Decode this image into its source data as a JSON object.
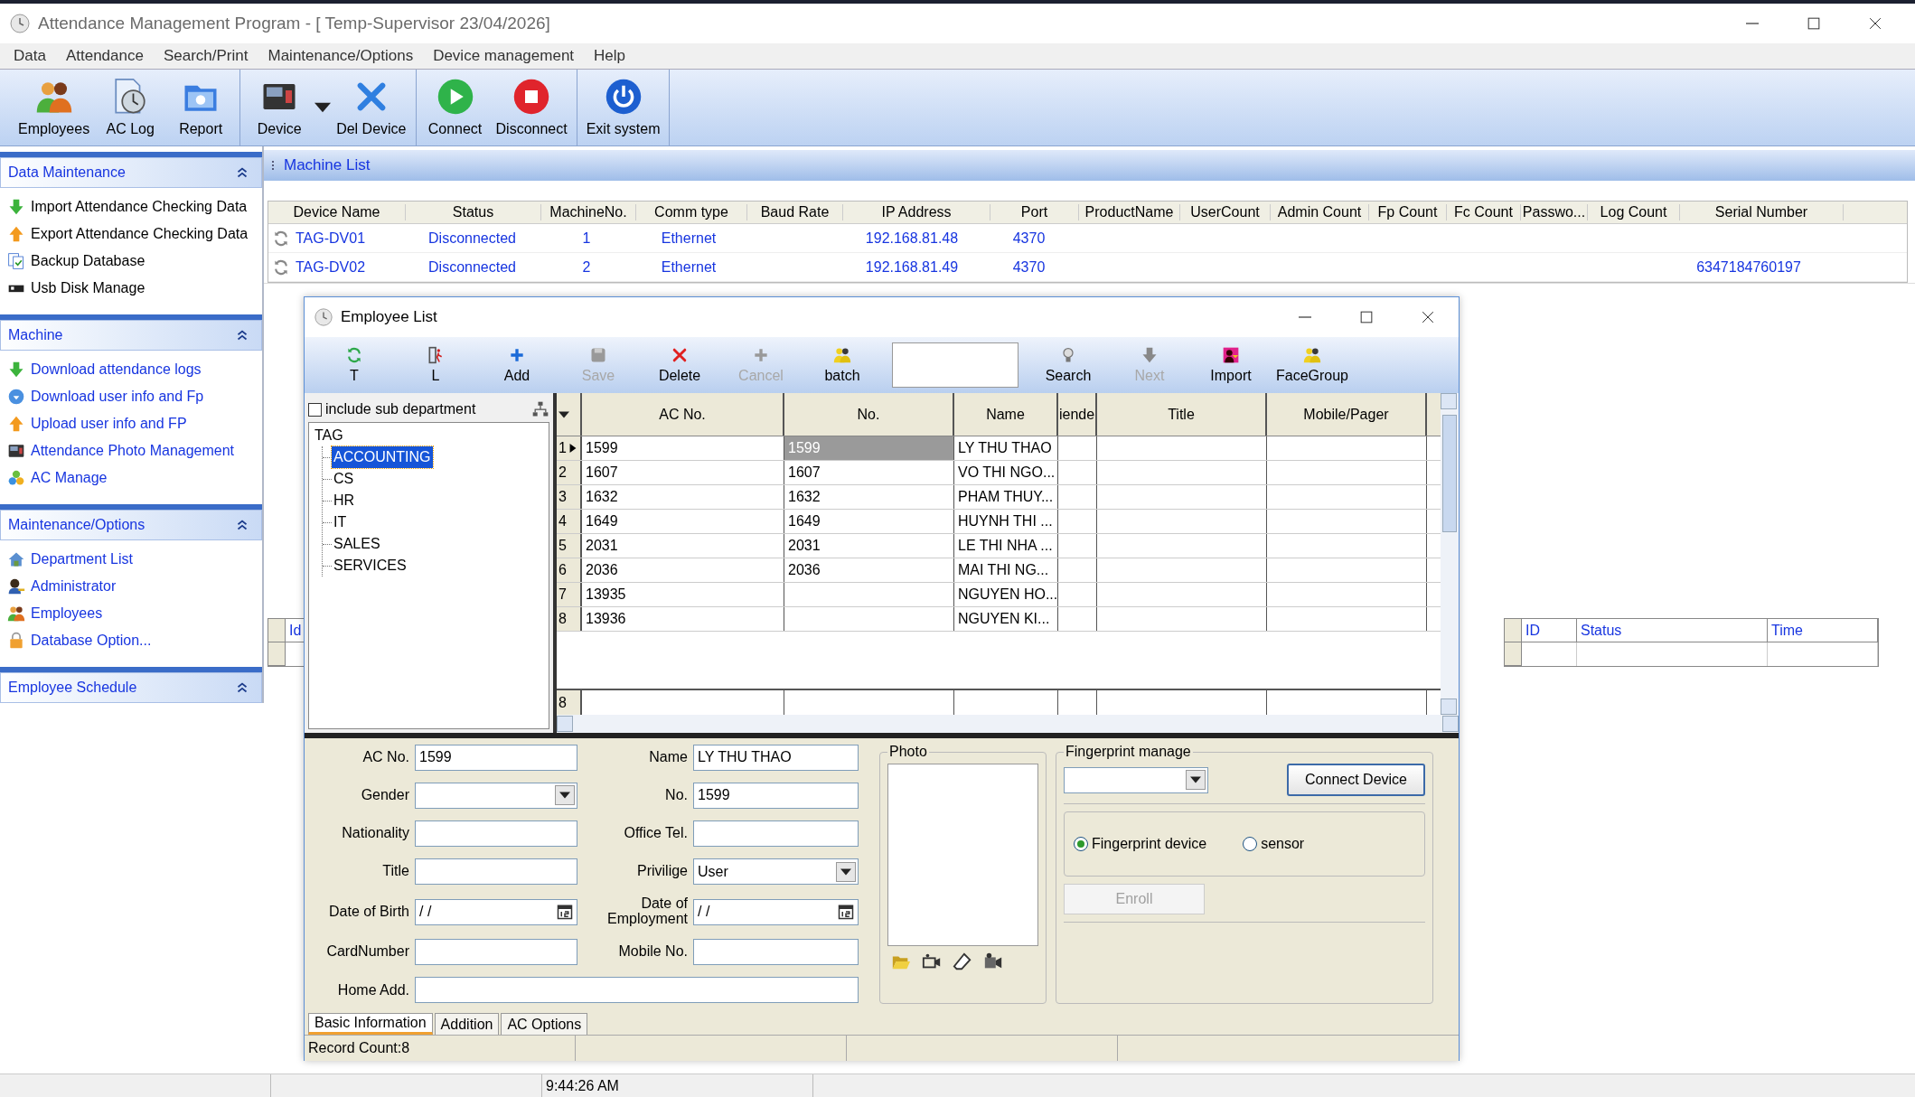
{
  "window": {
    "title": "Attendance Management Program - [ Temp-Supervisor 23/04/2026]"
  },
  "menu": [
    "Data",
    "Attendance",
    "Search/Print",
    "Maintenance/Options",
    "Device management",
    "Help"
  ],
  "toolbar": [
    {
      "buttons": [
        {
          "label": "Employees",
          "dropdown": false
        },
        {
          "label": "AC Log",
          "dropdown": false
        },
        {
          "label": "Report",
          "dropdown": false
        }
      ]
    },
    {
      "buttons": [
        {
          "label": "Device",
          "dropdown": true
        },
        {
          "label": "Del Device",
          "dropdown": false
        }
      ]
    },
    {
      "buttons": [
        {
          "label": "Connect",
          "dropdown": false
        },
        {
          "label": "Disconnect",
          "dropdown": false
        }
      ]
    },
    {
      "buttons": [
        {
          "label": "Exit system",
          "dropdown": false
        }
      ]
    }
  ],
  "sidebar": [
    {
      "title": "Data Maintenance",
      "expanded": true,
      "items": [
        {
          "label": "Import Attendance Checking Data",
          "kind": "plain"
        },
        {
          "label": "Export Attendance Checking Data",
          "kind": "plain"
        },
        {
          "label": "Backup Database",
          "kind": "plain"
        },
        {
          "label": "Usb Disk Manage",
          "kind": "plain"
        }
      ]
    },
    {
      "title": "Machine",
      "expanded": true,
      "items": [
        {
          "label": "Download attendance logs",
          "kind": "link"
        },
        {
          "label": "Download user info and Fp",
          "kind": "link"
        },
        {
          "label": "Upload user info and FP",
          "kind": "link"
        },
        {
          "label": "Attendance Photo Management",
          "kind": "link"
        },
        {
          "label": "AC Manage",
          "kind": "link"
        }
      ]
    },
    {
      "title": "Maintenance/Options",
      "expanded": true,
      "items": [
        {
          "label": "Department List",
          "kind": "link"
        },
        {
          "label": "Administrator",
          "kind": "link"
        },
        {
          "label": "Employees",
          "kind": "link"
        },
        {
          "label": "Database Option...",
          "kind": "link"
        }
      ]
    },
    {
      "title": "Employee Schedule",
      "expanded": true
    }
  ],
  "machine_list": {
    "title": "Machine List",
    "columns": [
      "Device Name",
      "Status",
      "MachineNo.",
      "Comm type",
      "Baud Rate",
      "IP Address",
      "Port",
      "ProductName",
      "UserCount",
      "Admin Count",
      "Fp Count",
      "Fc Count",
      "Passwo...",
      "Log Count",
      "Serial Number"
    ],
    "rows": [
      {
        "device_name": "TAG-DV01",
        "status": "Disconnected",
        "machine_no": "1",
        "comm_type": "Ethernet",
        "ip_address": "192.168.81.48",
        "port": "4370"
      },
      {
        "device_name": "TAG-DV02",
        "status": "Disconnected",
        "machine_no": "2",
        "comm_type": "Ethernet",
        "ip_address": "192.168.81.49",
        "port": "4370",
        "serial_number": "6347184760197"
      }
    ]
  },
  "log_grids": [
    {
      "columns": [
        "Id"
      ]
    },
    {
      "columns": [
        "ID",
        "Status",
        "Time"
      ]
    }
  ],
  "employee_list": {
    "title": "Employee List",
    "toolbar": [
      {
        "kind": "button",
        "label": "T",
        "disabled": false
      },
      {
        "kind": "button",
        "label": "L",
        "disabled": false
      },
      {
        "kind": "button",
        "label": "Add",
        "disabled": false
      },
      {
        "kind": "button",
        "label": "Save",
        "disabled": true
      },
      {
        "kind": "button",
        "label": "Delete",
        "disabled": false
      },
      {
        "kind": "button",
        "label": "Cancel",
        "disabled": true
      },
      {
        "kind": "button",
        "label": "batch",
        "disabled": false
      },
      {
        "kind": "field"
      },
      {
        "kind": "button",
        "label": "Search",
        "disabled": false
      },
      {
        "kind": "button",
        "label": "Next",
        "disabled": true
      },
      {
        "kind": "button",
        "label": "Import",
        "disabled": false
      },
      {
        "kind": "button",
        "label": "FaceGroup",
        "disabled": false
      }
    ],
    "include_sub": {
      "label": "include sub department",
      "checked": false
    },
    "tree": {
      "label": "TAG",
      "selected": false,
      "children": [
        {
          "label": "ACCOUNTING",
          "selected": true
        },
        {
          "label": "CS",
          "selected": false
        },
        {
          "label": "HR",
          "selected": false
        },
        {
          "label": "IT",
          "selected": false
        },
        {
          "label": "SALES",
          "selected": false
        },
        {
          "label": "SERVICES",
          "selected": false
        }
      ]
    },
    "grid": {
      "columns": [
        "AC No.",
        "No.",
        "Name",
        "iende",
        "Title",
        "Mobile/Pager"
      ],
      "rows": [
        {
          "number": "1",
          "ac_no": "1599",
          "no": "1599",
          "name": "LY THU THAO",
          "selected": true
        },
        {
          "number": "2",
          "ac_no": "1607",
          "no": "1607",
          "name": "VO THI NGO...",
          "selected": false
        },
        {
          "number": "3",
          "ac_no": "1632",
          "no": "1632",
          "name": "PHAM THUY...",
          "selected": false
        },
        {
          "number": "4",
          "ac_no": "1649",
          "no": "1649",
          "name": "HUYNH THI ...",
          "selected": false
        },
        {
          "number": "5",
          "ac_no": "2031",
          "no": "2031",
          "name": "LE THI NHA ...",
          "selected": false
        },
        {
          "number": "6",
          "ac_no": "2036",
          "no": "2036",
          "name": "MAI THI NG...",
          "selected": false
        },
        {
          "number": "7",
          "ac_no": "13935",
          "name": "NGUYEN HO...",
          "selected": false
        },
        {
          "number": "8",
          "ac_no": "13936",
          "name": "NGUYEN KI...",
          "selected": false
        }
      ],
      "footer": "8"
    },
    "form": {
      "left": [
        {
          "label": "AC No.",
          "kind": "text",
          "value": "1599"
        },
        {
          "label": "Gender",
          "kind": "select"
        },
        {
          "label": "Nationality",
          "kind": "text"
        },
        {
          "label": "Title",
          "kind": "text"
        },
        {
          "label": "Date of Birth",
          "kind": "date",
          "value": "/ /"
        },
        {
          "label": "CardNumber",
          "kind": "text"
        }
      ],
      "right": [
        {
          "label": "Name",
          "kind": "text",
          "value": "LY THU THAO"
        },
        {
          "label": "No.",
          "kind": "text",
          "value": "1599"
        },
        {
          "label": "Office Tel.",
          "kind": "text"
        },
        {
          "label": "Privilige",
          "kind": "select",
          "value": "User"
        },
        {
          "label": "Date of Employment",
          "kind": "date",
          "value": "/ /"
        },
        {
          "label": "Mobile No.",
          "kind": "text"
        }
      ],
      "home": {
        "label": "Home Add.",
        "kind": "text"
      }
    },
    "photo": {
      "title": "Photo"
    },
    "fingerprint": {
      "title": "Fingerprint manage",
      "connect": "Connect Device",
      "options": [
        {
          "label": "Fingerprint device",
          "selected": true
        },
        {
          "label": "sensor",
          "selected": false
        }
      ],
      "enroll": {
        "label": "Enroll",
        "disabled": true
      }
    },
    "tabs": [
      {
        "label": "Basic Information",
        "selected": true
      },
      {
        "label": "Addition",
        "selected": false
      },
      {
        "label": "AC Options",
        "selected": false
      }
    ],
    "status": [
      "Record Count:8"
    ]
  },
  "status_bar": {
    "time": "9:44:26 AM"
  }
}
